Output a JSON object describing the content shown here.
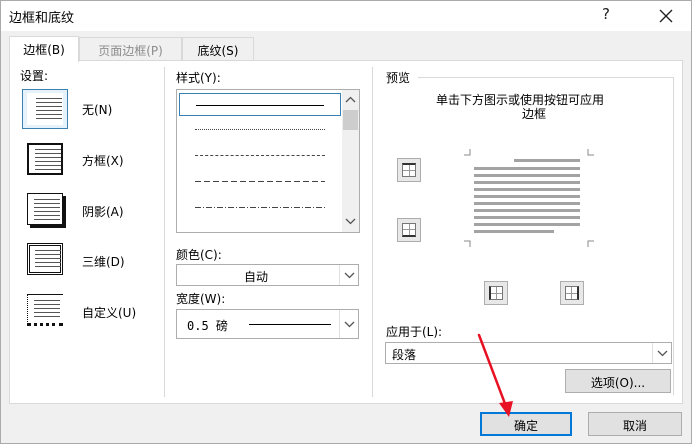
{
  "dialog": {
    "title": "边框和底纹",
    "help": "?",
    "close_icon": "close-icon"
  },
  "tabs": [
    {
      "label": "边框(B)",
      "active": true
    },
    {
      "label": "页面边框(P)",
      "active": false,
      "disabled": true
    },
    {
      "label": "底纹(S)",
      "active": false
    }
  ],
  "settings": {
    "label": "设置:",
    "items": [
      {
        "label": "无(N)",
        "icon": "none-border-icon",
        "selected": true
      },
      {
        "label": "方框(X)",
        "icon": "box-border-icon",
        "selected": false
      },
      {
        "label": "阴影(A)",
        "icon": "shadow-border-icon",
        "selected": false
      },
      {
        "label": "三维(D)",
        "icon": "3d-border-icon",
        "selected": false
      },
      {
        "label": "自定义(U)",
        "icon": "custom-border-icon",
        "selected": false
      }
    ]
  },
  "style": {
    "label": "样式(Y):",
    "items": [
      "solid",
      "dotted",
      "dashed-small",
      "dashed-large",
      "dash-dot"
    ]
  },
  "color": {
    "label": "颜色(C):",
    "value": "自动"
  },
  "width": {
    "label": "宽度(W):",
    "value": "0.5 磅"
  },
  "preview": {
    "label": "预览",
    "hint_line1": "单击下方图示或使用按钮可应用",
    "hint_line2": "边框"
  },
  "apply_to": {
    "label": "应用于(L):",
    "value": "段落"
  },
  "options_button": "选项(O)...",
  "ok_button": "确定",
  "cancel_button": "取消",
  "colors": {
    "accent": "#0078d7",
    "selection": "#3c7fb1",
    "arrow": "#e81123"
  }
}
